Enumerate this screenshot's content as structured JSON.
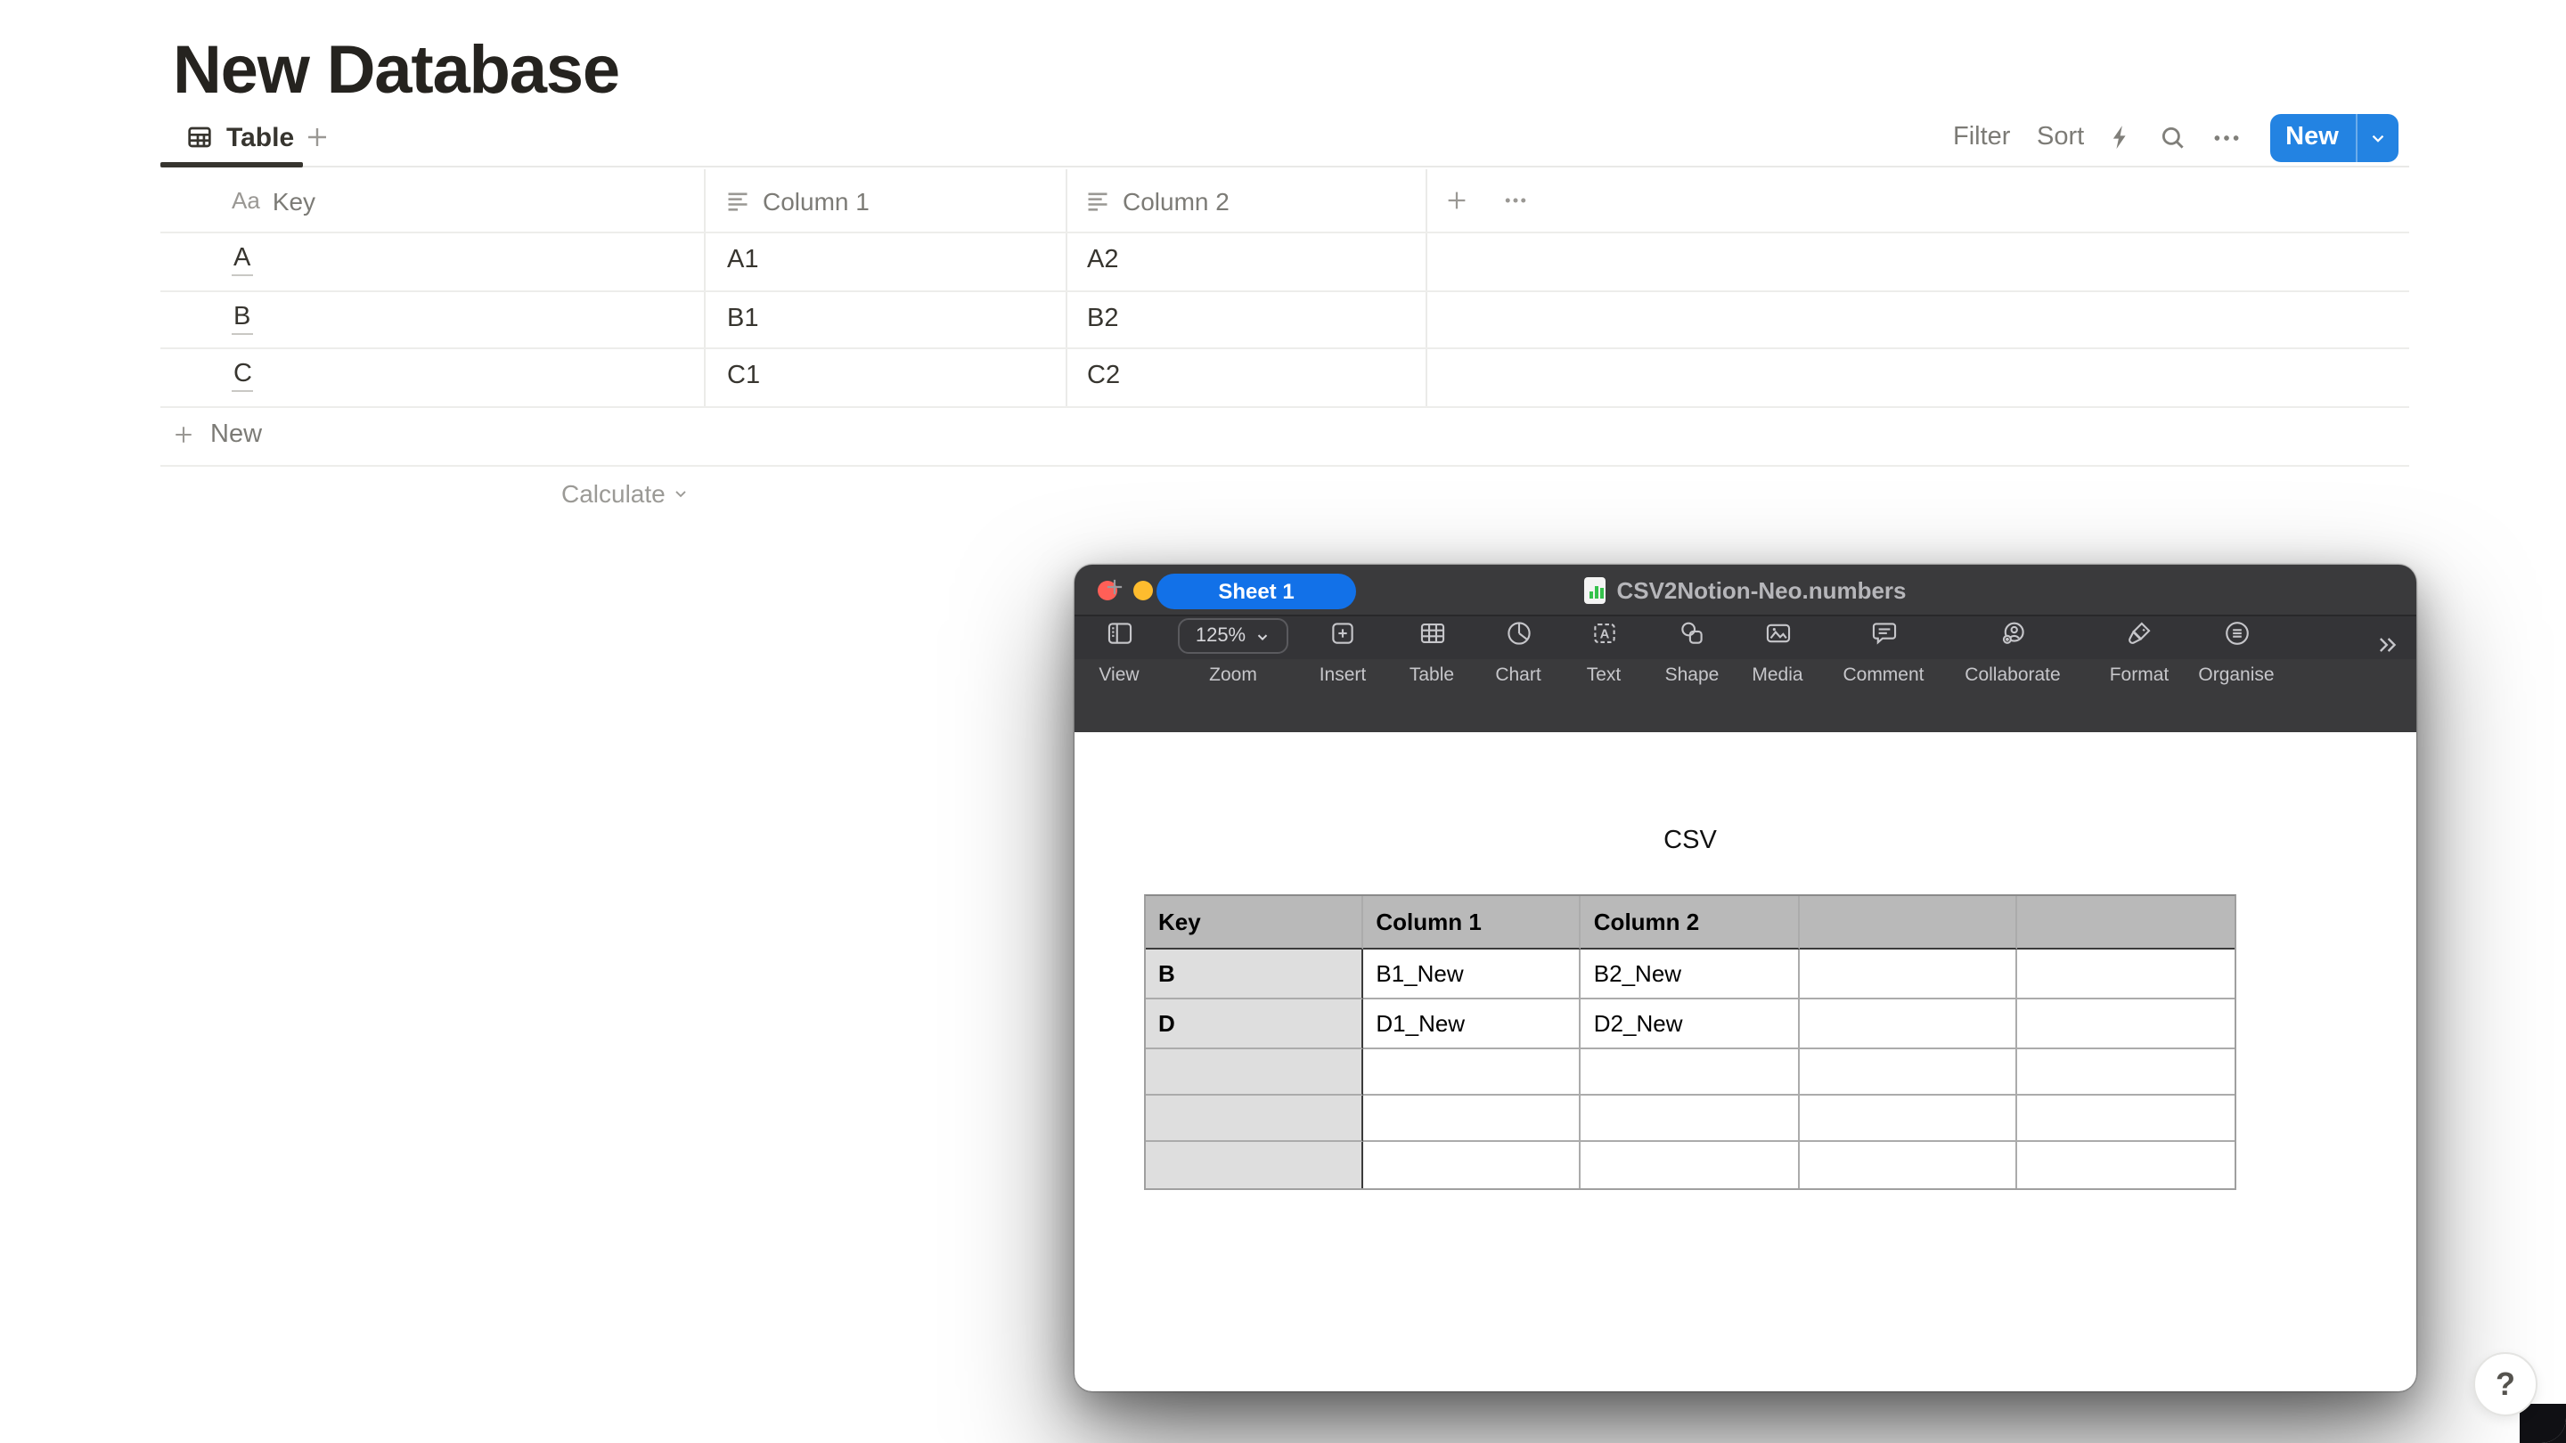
{
  "colors": {
    "notion-accent": "#2383e2",
    "numbers-accent": "#1271e8",
    "traffic-close": "#ff5f57",
    "traffic-minimize": "#febc2e",
    "traffic-zoom": "#28c840"
  },
  "notion": {
    "page_title": "New Database",
    "view_tabs": {
      "table_tab": "Table",
      "add_view_icon": "plus-icon"
    },
    "toolbar": {
      "filter_label": "Filter",
      "sort_label": "Sort",
      "bolt_icon": "lightning-icon",
      "search_icon": "magnifier-icon",
      "more_icon": "ellipsis-icon",
      "new_button_label": "New"
    },
    "table": {
      "columns": [
        {
          "label": "Key",
          "type_icon": "title-Aa-icon",
          "type_glyph": "Aa"
        },
        {
          "label": "Column 1",
          "type_icon": "text-lines-icon"
        },
        {
          "label": "Column 2",
          "type_icon": "text-lines-icon"
        }
      ],
      "rows": [
        {
          "key": "A",
          "col1": "A1",
          "col2": "A2"
        },
        {
          "key": "B",
          "col1": "B1",
          "col2": "B2"
        },
        {
          "key": "C",
          "col1": "C1",
          "col2": "C2"
        }
      ],
      "new_row_label": "New",
      "calculate_label": "Calculate"
    },
    "help_button_label": "?"
  },
  "numbers": {
    "window_title": "CSV2Notion-Neo.numbers",
    "toolbar": [
      {
        "icon": "sidebar-view-icon",
        "label": "View"
      },
      {
        "icon": "zoom-dropdown",
        "label": "Zoom",
        "value": "125%"
      },
      {
        "icon": "insert-plus-icon",
        "label": "Insert"
      },
      {
        "icon": "table-grid-icon",
        "label": "Table"
      },
      {
        "icon": "pie-chart-icon",
        "label": "Chart"
      },
      {
        "icon": "text-box-icon",
        "label": "Text"
      },
      {
        "icon": "shapes-icon",
        "label": "Shape"
      },
      {
        "icon": "photo-icon",
        "label": "Media"
      },
      {
        "icon": "comment-bubble-icon",
        "label": "Comment"
      },
      {
        "icon": "collaborate-person-icon",
        "label": "Collaborate"
      },
      {
        "icon": "format-brush-icon",
        "label": "Format"
      },
      {
        "icon": "organise-circle-icon",
        "label": "Organise"
      }
    ],
    "overflow_icon": "double-chevron-right-icon",
    "sheet_bar": {
      "add_sheet_icon": "plus-icon",
      "active_sheet": "Sheet 1"
    },
    "sheet_title": "CSV",
    "table": {
      "headers": [
        "Key",
        "Column 1",
        "Column 2",
        "",
        ""
      ],
      "rows": [
        [
          "B",
          "B1_New",
          "B2_New",
          "",
          ""
        ],
        [
          "D",
          "D1_New",
          "D2_New",
          "",
          ""
        ],
        [
          "",
          "",
          "",
          "",
          ""
        ],
        [
          "",
          "",
          "",
          "",
          ""
        ],
        [
          "",
          "",
          "",
          "",
          ""
        ]
      ]
    }
  }
}
